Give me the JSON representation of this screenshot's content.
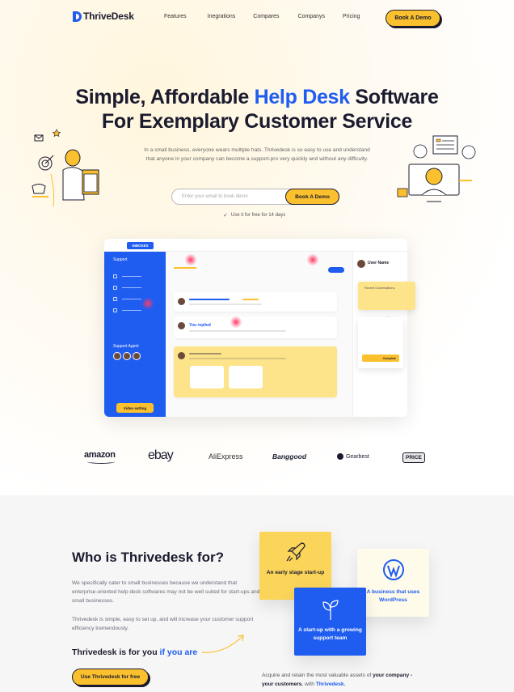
{
  "nav": {
    "logo": "ThriveDesk",
    "links": [
      "Features",
      "Inegrations",
      "Compares",
      "Companys",
      "Pricing"
    ],
    "cta": "Book A Demo"
  },
  "hero": {
    "line1_pre": "Simple, Affordable ",
    "line1_accent": "Help Desk",
    "line1_post": " Software",
    "line2": "For Exemplary Customer Service",
    "subtext": "In a small business, everyone wears multiple hats. Thrivedesk is so easy to use and understand that anyone in your company can become a support-pro very quickly and without any difficulty.",
    "email_placeholder": "Enter your email to book demo",
    "email_button": "Book A Demo",
    "free_note": "Use it for free for 14 days"
  },
  "mockup": {
    "inbox_tab": "INBOXES",
    "sidebar_title": "Support",
    "support_agent": "Support Agent",
    "video_button": "Video setting",
    "you_replied": "You replied",
    "user_name": "User Name",
    "recent_conversations": "Recent Conversations",
    "complete_button": "Complete",
    "reply_label": "Reply"
  },
  "brands": [
    "amazon",
    "ebay",
    "AliExpress",
    "Banggood",
    "Gearbest",
    "PRICE"
  ],
  "who": {
    "title": "Who is Thrivedesk for?",
    "para1": "We specifically cater to small businesses because we understand that enterprise-oriented help desk softwares may not be well suited for start-ups and small businesses.",
    "para2": "Thrivedesk is simple, easy to set up, and will increase your customer support efficiency tremendously.",
    "for_you_pre": "Thrivedesk is for you ",
    "for_you_accent": "if you are",
    "use_button": "Use Thrivedesk for free",
    "cards": [
      {
        "label": "An early stage start-up",
        "icon": "rocket-icon"
      },
      {
        "label": "A business that uses WordPress",
        "icon": "wordpress-icon"
      },
      {
        "label": "A start-up with a growing support team",
        "icon": "plant-icon"
      }
    ],
    "acquire_pre": "Acquire and retain the most valuable assets of ",
    "acquire_bold": "your company - your customers",
    "acquire_mid": ", with ",
    "acquire_brand": "Thrivedesk."
  },
  "colors": {
    "accent": "#1f5cf0",
    "yellow": "#fbc02d",
    "dark": "#1b1b2f"
  }
}
